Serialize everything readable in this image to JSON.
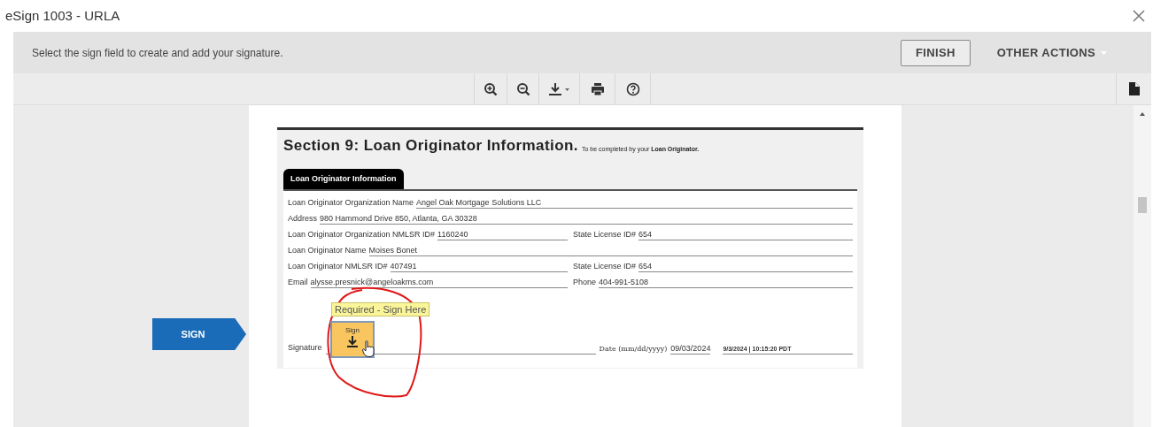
{
  "window": {
    "title": "eSign 1003 - URLA"
  },
  "header": {
    "instruction": "Select the sign field to create and add your signature.",
    "buttons": [
      "FINISH",
      "OTHER ACTIONS"
    ]
  },
  "sign_tag": {
    "label": "SIGN"
  },
  "document": {
    "title": "Section 9: Loan Originator Information.",
    "subtitle": "To be completed by your **Loan Originator.**",
    "tab": "Loan Originator Information",
    "rows": [
      {
        "fields": [
          {
            "label": "Loan Originator Organization Name",
            "value": "Angel Oak Mortgage Solutions LLC"
          }
        ]
      },
      {
        "fields": [
          {
            "label": "Address",
            "value": "980 Hammond Drive 850, Atlanta, GA 30328"
          }
        ]
      },
      {
        "fields": [
          {
            "label": "Loan Originator Organization NMLSR ID#",
            "value": "1160240"
          },
          {
            "label": "State License ID#",
            "value": "654"
          }
        ]
      },
      {
        "fields": [
          {
            "label": "Loan Originator Name",
            "value": "Moises Bonet"
          }
        ]
      },
      {
        "fields": [
          {
            "label": "Loan Originator NMLSR ID#",
            "value": "407491"
          },
          {
            "label": "State License ID#",
            "value": "654"
          }
        ]
      },
      {
        "fields": [
          {
            "label": "Email",
            "value": "alysse.presnick@angeloakms.com"
          },
          {
            "label": "Phone",
            "value": "404-991-5108"
          }
        ]
      }
    ],
    "signature": {
      "tooltip": "Required - Sign Here",
      "button": "Sign",
      "label": "Signature",
      "date_label": "Date (mm/dd/yyyy)",
      "date_value": "09/03/2024",
      "timestamp": "9/3/2024 | 10:15:20 PDT"
    }
  }
}
